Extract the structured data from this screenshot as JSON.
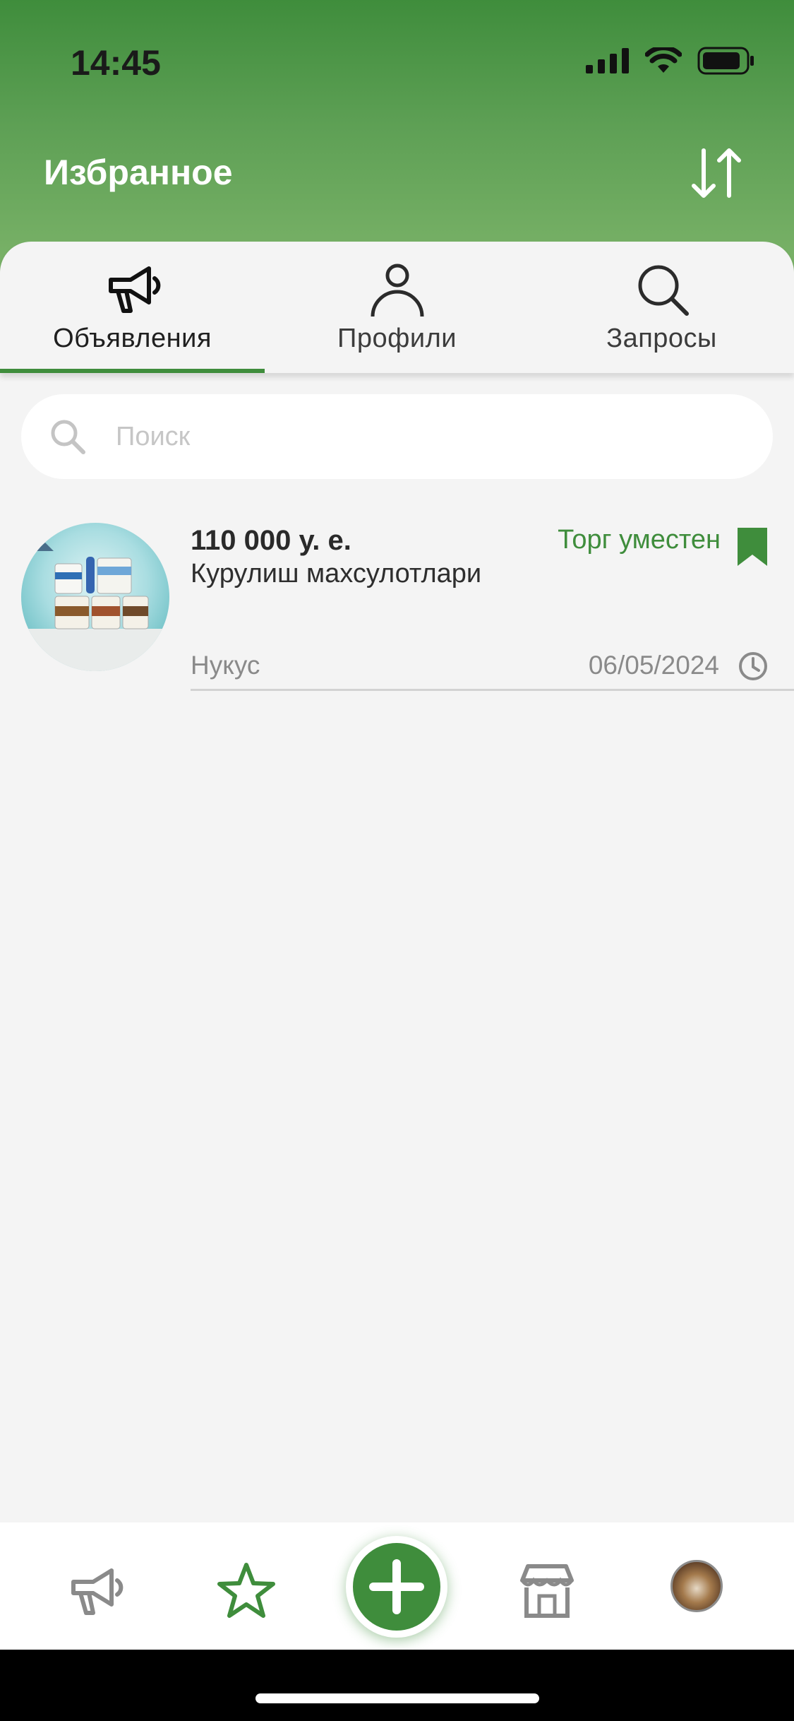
{
  "status_bar": {
    "time": "14:45"
  },
  "header": {
    "title": "Избранное",
    "sort_icon": "sort-arrows-icon"
  },
  "tabs": [
    {
      "label": "Объявления",
      "icon": "megaphone-icon",
      "active": true
    },
    {
      "label": "Профили",
      "icon": "person-icon",
      "active": false
    },
    {
      "label": "Запросы",
      "icon": "search-icon",
      "active": false
    }
  ],
  "search": {
    "placeholder": "Поиск",
    "value": ""
  },
  "listings": [
    {
      "price": "110 000 у. е.",
      "title": "Курулиш махсулотлари",
      "negotiable": "Торг уместен",
      "city": "Нукус",
      "date": "06/05/2024",
      "bookmarked": true
    }
  ],
  "bottom_nav": [
    {
      "name": "announcements",
      "icon": "megaphone-icon"
    },
    {
      "name": "favorites",
      "icon": "star-icon",
      "active": true
    },
    {
      "name": "add",
      "icon": "plus-icon"
    },
    {
      "name": "store",
      "icon": "store-icon"
    },
    {
      "name": "profile",
      "icon": "avatar"
    }
  ],
  "colors": {
    "accent": "#3f8d3c",
    "background": "#f4f4f4"
  }
}
